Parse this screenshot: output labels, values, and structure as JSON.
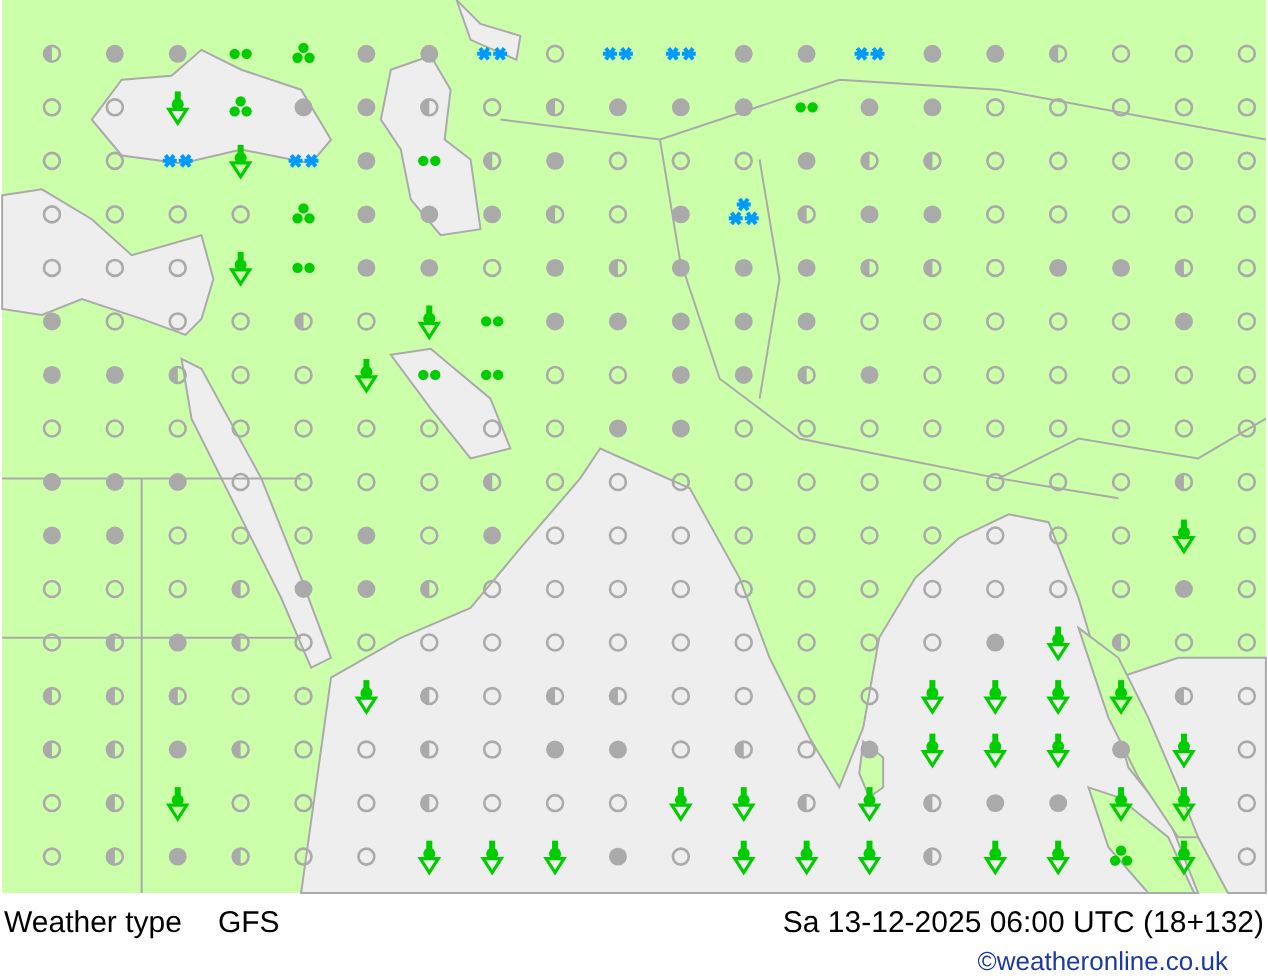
{
  "map": {
    "rows": [
      [
        {
          "kind": "partly"
        },
        {
          "kind": "overcast"
        },
        {
          "kind": "overcast"
        },
        {
          "kind": "drizzle"
        },
        {
          "kind": "rain"
        },
        {
          "kind": "overcast"
        },
        {
          "kind": "overcast"
        },
        {
          "kind": "snow"
        },
        {
          "kind": "clear"
        },
        {
          "kind": "snow"
        },
        {
          "kind": "snow"
        },
        {
          "kind": "overcast"
        },
        {
          "kind": "overcast"
        },
        {
          "kind": "snow"
        },
        {
          "kind": "overcast"
        },
        {
          "kind": "overcast"
        },
        {
          "kind": "partly"
        },
        {
          "kind": "clear"
        },
        {
          "kind": "clear"
        },
        {
          "kind": "clear"
        }
      ],
      [
        {
          "kind": "clear"
        },
        {
          "kind": "clear"
        },
        {
          "kind": "shower"
        },
        {
          "kind": "rain"
        },
        {
          "kind": "overcast"
        },
        {
          "kind": "overcast"
        },
        {
          "kind": "partly"
        },
        {
          "kind": "clear"
        },
        {
          "kind": "partly"
        },
        {
          "kind": "overcast"
        },
        {
          "kind": "overcast"
        },
        {
          "kind": "overcast"
        },
        {
          "kind": "drizzle"
        },
        {
          "kind": "overcast"
        },
        {
          "kind": "overcast"
        },
        {
          "kind": "clear"
        },
        {
          "kind": "clear"
        },
        {
          "kind": "clear"
        },
        {
          "kind": "clear"
        },
        {
          "kind": "clear"
        }
      ],
      [
        {
          "kind": "clear"
        },
        {
          "kind": "clear"
        },
        {
          "kind": "snow"
        },
        {
          "kind": "shower"
        },
        {
          "kind": "snow"
        },
        {
          "kind": "overcast"
        },
        {
          "kind": "drizzle"
        },
        {
          "kind": "partly"
        },
        {
          "kind": "overcast"
        },
        {
          "kind": "clear"
        },
        {
          "kind": "clear"
        },
        {
          "kind": "clear"
        },
        {
          "kind": "overcast"
        },
        {
          "kind": "partly"
        },
        {
          "kind": "partly"
        },
        {
          "kind": "clear"
        },
        {
          "kind": "clear"
        },
        {
          "kind": "clear"
        },
        {
          "kind": "clear"
        },
        {
          "kind": "clear"
        }
      ],
      [
        {
          "kind": "clear"
        },
        {
          "kind": "clear"
        },
        {
          "kind": "clear"
        },
        {
          "kind": "clear"
        },
        {
          "kind": "rain"
        },
        {
          "kind": "overcast"
        },
        {
          "kind": "overcast"
        },
        {
          "kind": "overcast"
        },
        {
          "kind": "partly"
        },
        {
          "kind": "clear"
        },
        {
          "kind": "overcast"
        },
        {
          "kind": "snowshower"
        },
        {
          "kind": "partly"
        },
        {
          "kind": "overcast"
        },
        {
          "kind": "overcast"
        },
        {
          "kind": "clear"
        },
        {
          "kind": "clear"
        },
        {
          "kind": "clear"
        },
        {
          "kind": "clear"
        },
        {
          "kind": "clear"
        }
      ],
      [
        {
          "kind": "clear"
        },
        {
          "kind": "clear"
        },
        {
          "kind": "clear"
        },
        {
          "kind": "shower"
        },
        {
          "kind": "drizzle"
        },
        {
          "kind": "overcast"
        },
        {
          "kind": "overcast"
        },
        {
          "kind": "clear"
        },
        {
          "kind": "overcast"
        },
        {
          "kind": "partly"
        },
        {
          "kind": "overcast"
        },
        {
          "kind": "overcast"
        },
        {
          "kind": "overcast"
        },
        {
          "kind": "partly"
        },
        {
          "kind": "partly"
        },
        {
          "kind": "clear"
        },
        {
          "kind": "overcast"
        },
        {
          "kind": "overcast"
        },
        {
          "kind": "partly"
        },
        {
          "kind": "clear"
        }
      ],
      [
        {
          "kind": "overcast"
        },
        {
          "kind": "clear"
        },
        {
          "kind": "clear"
        },
        {
          "kind": "clear"
        },
        {
          "kind": "partly"
        },
        {
          "kind": "clear"
        },
        {
          "kind": "shower"
        },
        {
          "kind": "drizzle"
        },
        {
          "kind": "overcast"
        },
        {
          "kind": "overcast"
        },
        {
          "kind": "overcast"
        },
        {
          "kind": "overcast"
        },
        {
          "kind": "overcast"
        },
        {
          "kind": "clear"
        },
        {
          "kind": "clear"
        },
        {
          "kind": "clear"
        },
        {
          "kind": "clear"
        },
        {
          "kind": "clear"
        },
        {
          "kind": "overcast"
        },
        {
          "kind": "clear"
        }
      ],
      [
        {
          "kind": "overcast"
        },
        {
          "kind": "overcast"
        },
        {
          "kind": "partly"
        },
        {
          "kind": "clear"
        },
        {
          "kind": "clear"
        },
        {
          "kind": "shower"
        },
        {
          "kind": "drizzle"
        },
        {
          "kind": "drizzle"
        },
        {
          "kind": "clear"
        },
        {
          "kind": "clear"
        },
        {
          "kind": "overcast"
        },
        {
          "kind": "overcast"
        },
        {
          "kind": "partly"
        },
        {
          "kind": "overcast"
        },
        {
          "kind": "clear"
        },
        {
          "kind": "clear"
        },
        {
          "kind": "clear"
        },
        {
          "kind": "clear"
        },
        {
          "kind": "clear"
        },
        {
          "kind": "clear"
        }
      ],
      [
        {
          "kind": "clear"
        },
        {
          "kind": "clear"
        },
        {
          "kind": "clear"
        },
        {
          "kind": "clear"
        },
        {
          "kind": "clear"
        },
        {
          "kind": "clear"
        },
        {
          "kind": "clear"
        },
        {
          "kind": "clear"
        },
        {
          "kind": "clear"
        },
        {
          "kind": "overcast"
        },
        {
          "kind": "overcast"
        },
        {
          "kind": "clear"
        },
        {
          "kind": "clear"
        },
        {
          "kind": "clear"
        },
        {
          "kind": "clear"
        },
        {
          "kind": "clear"
        },
        {
          "kind": "clear"
        },
        {
          "kind": "clear"
        },
        {
          "kind": "clear"
        },
        {
          "kind": "clear"
        }
      ],
      [
        {
          "kind": "overcast"
        },
        {
          "kind": "overcast"
        },
        {
          "kind": "overcast"
        },
        {
          "kind": "clear"
        },
        {
          "kind": "clear"
        },
        {
          "kind": "clear"
        },
        {
          "kind": "clear"
        },
        {
          "kind": "partly"
        },
        {
          "kind": "clear"
        },
        {
          "kind": "clear"
        },
        {
          "kind": "clear"
        },
        {
          "kind": "clear"
        },
        {
          "kind": "clear"
        },
        {
          "kind": "clear"
        },
        {
          "kind": "clear"
        },
        {
          "kind": "clear"
        },
        {
          "kind": "clear"
        },
        {
          "kind": "clear"
        },
        {
          "kind": "partly"
        },
        {
          "kind": "clear"
        }
      ],
      [
        {
          "kind": "overcast"
        },
        {
          "kind": "overcast"
        },
        {
          "kind": "clear"
        },
        {
          "kind": "clear"
        },
        {
          "kind": "clear"
        },
        {
          "kind": "overcast"
        },
        {
          "kind": "clear"
        },
        {
          "kind": "overcast"
        },
        {
          "kind": "clear"
        },
        {
          "kind": "clear"
        },
        {
          "kind": "clear"
        },
        {
          "kind": "clear"
        },
        {
          "kind": "clear"
        },
        {
          "kind": "clear"
        },
        {
          "kind": "clear"
        },
        {
          "kind": "clear"
        },
        {
          "kind": "clear"
        },
        {
          "kind": "clear"
        },
        {
          "kind": "shower"
        },
        {
          "kind": "clear"
        }
      ],
      [
        {
          "kind": "clear"
        },
        {
          "kind": "clear"
        },
        {
          "kind": "clear"
        },
        {
          "kind": "partly"
        },
        {
          "kind": "overcast"
        },
        {
          "kind": "overcast"
        },
        {
          "kind": "partly"
        },
        {
          "kind": "clear"
        },
        {
          "kind": "clear"
        },
        {
          "kind": "clear"
        },
        {
          "kind": "clear"
        },
        {
          "kind": "clear"
        },
        {
          "kind": "clear"
        },
        {
          "kind": "clear"
        },
        {
          "kind": "clear"
        },
        {
          "kind": "clear"
        },
        {
          "kind": "clear"
        },
        {
          "kind": "clear"
        },
        {
          "kind": "overcast"
        },
        {
          "kind": "clear"
        }
      ],
      [
        {
          "kind": "clear"
        },
        {
          "kind": "partly"
        },
        {
          "kind": "overcast"
        },
        {
          "kind": "partly"
        },
        {
          "kind": "clear"
        },
        {
          "kind": "clear"
        },
        {
          "kind": "clear"
        },
        {
          "kind": "clear"
        },
        {
          "kind": "clear"
        },
        {
          "kind": "clear"
        },
        {
          "kind": "clear"
        },
        {
          "kind": "clear"
        },
        {
          "kind": "clear"
        },
        {
          "kind": "clear"
        },
        {
          "kind": "clear"
        },
        {
          "kind": "overcast"
        },
        {
          "kind": "shower"
        },
        {
          "kind": "partly"
        },
        {
          "kind": "clear"
        },
        {
          "kind": "clear"
        }
      ],
      [
        {
          "kind": "partly"
        },
        {
          "kind": "partly"
        },
        {
          "kind": "partly"
        },
        {
          "kind": "clear"
        },
        {
          "kind": "clear"
        },
        {
          "kind": "shower"
        },
        {
          "kind": "partly"
        },
        {
          "kind": "clear"
        },
        {
          "kind": "partly"
        },
        {
          "kind": "partly"
        },
        {
          "kind": "clear"
        },
        {
          "kind": "clear"
        },
        {
          "kind": "clear"
        },
        {
          "kind": "clear"
        },
        {
          "kind": "shower"
        },
        {
          "kind": "shower"
        },
        {
          "kind": "shower"
        },
        {
          "kind": "shower"
        },
        {
          "kind": "partly"
        },
        {
          "kind": "clear"
        }
      ],
      [
        {
          "kind": "partly"
        },
        {
          "kind": "partly"
        },
        {
          "kind": "overcast"
        },
        {
          "kind": "partly"
        },
        {
          "kind": "clear"
        },
        {
          "kind": "clear"
        },
        {
          "kind": "partly"
        },
        {
          "kind": "clear"
        },
        {
          "kind": "overcast"
        },
        {
          "kind": "overcast"
        },
        {
          "kind": "clear"
        },
        {
          "kind": "partly"
        },
        {
          "kind": "clear"
        },
        {
          "kind": "overcast"
        },
        {
          "kind": "shower"
        },
        {
          "kind": "shower"
        },
        {
          "kind": "shower"
        },
        {
          "kind": "overcast"
        },
        {
          "kind": "shower"
        },
        {
          "kind": "clear"
        }
      ],
      [
        {
          "kind": "clear"
        },
        {
          "kind": "partly"
        },
        {
          "kind": "shower"
        },
        {
          "kind": "clear"
        },
        {
          "kind": "clear"
        },
        {
          "kind": "clear"
        },
        {
          "kind": "partly"
        },
        {
          "kind": "clear"
        },
        {
          "kind": "clear"
        },
        {
          "kind": "clear"
        },
        {
          "kind": "shower"
        },
        {
          "kind": "shower"
        },
        {
          "kind": "partly"
        },
        {
          "kind": "shower"
        },
        {
          "kind": "partly"
        },
        {
          "kind": "overcast"
        },
        {
          "kind": "overcast"
        },
        {
          "kind": "shower"
        },
        {
          "kind": "shower"
        },
        {
          "kind": "clear"
        }
      ],
      [
        {
          "kind": "clear"
        },
        {
          "kind": "partly"
        },
        {
          "kind": "overcast"
        },
        {
          "kind": "partly"
        },
        {
          "kind": "clear"
        },
        {
          "kind": "clear"
        },
        {
          "kind": "shower"
        },
        {
          "kind": "shower"
        },
        {
          "kind": "shower"
        },
        {
          "kind": "overcast"
        },
        {
          "kind": "clear"
        },
        {
          "kind": "shower"
        },
        {
          "kind": "shower"
        },
        {
          "kind": "shower"
        },
        {
          "kind": "partly"
        },
        {
          "kind": "shower"
        },
        {
          "kind": "shower"
        },
        {
          "kind": "rain"
        },
        {
          "kind": "shower"
        },
        {
          "kind": "clear"
        }
      ]
    ]
  },
  "footer": {
    "title": "Weather type",
    "model": "GFS",
    "valid_time": "Sa 13-12-2025 06:00 UTC (18+132)",
    "credit": "©weatheronline.co.uk"
  }
}
